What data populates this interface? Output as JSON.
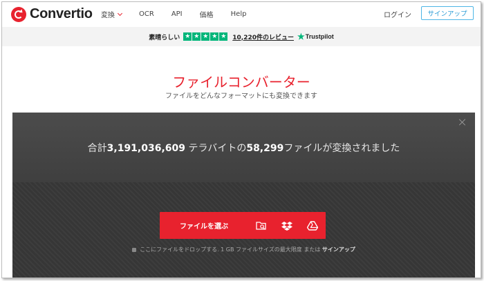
{
  "nav": {
    "logo_text": "Convertio",
    "links": [
      "変換",
      "OCR",
      "API",
      "価格",
      "Help"
    ],
    "login": "ログイン",
    "signup": "サインアップ"
  },
  "trust": {
    "label": "素晴らしい",
    "stars": 5,
    "reviews": "10,220件のレビュー",
    "provider": "Trustpilot"
  },
  "hero": {
    "title": "ファイルコンバーター",
    "subtitle": "ファイルをどんなフォーマットにも変換できます"
  },
  "stats": {
    "prefix": "合計",
    "total_tb": "3,191,036,609",
    "mid": " テラバイトの",
    "file_count": "58,299",
    "suffix": "ファイルが変換されました"
  },
  "upload": {
    "choose_label": "ファイルを選ぶ",
    "sources": [
      "folder-search-icon",
      "dropbox-icon",
      "google-drive-icon"
    ],
    "drop_hint": "ここにファイルをドロップする. 1 GB ファイルサイズの最大限度 または",
    "drop_hint_link": "サインアップ"
  },
  "colors": {
    "brand_red": "#e8222e",
    "trustpilot_green": "#00b67a",
    "panel_dark": "#363636"
  }
}
